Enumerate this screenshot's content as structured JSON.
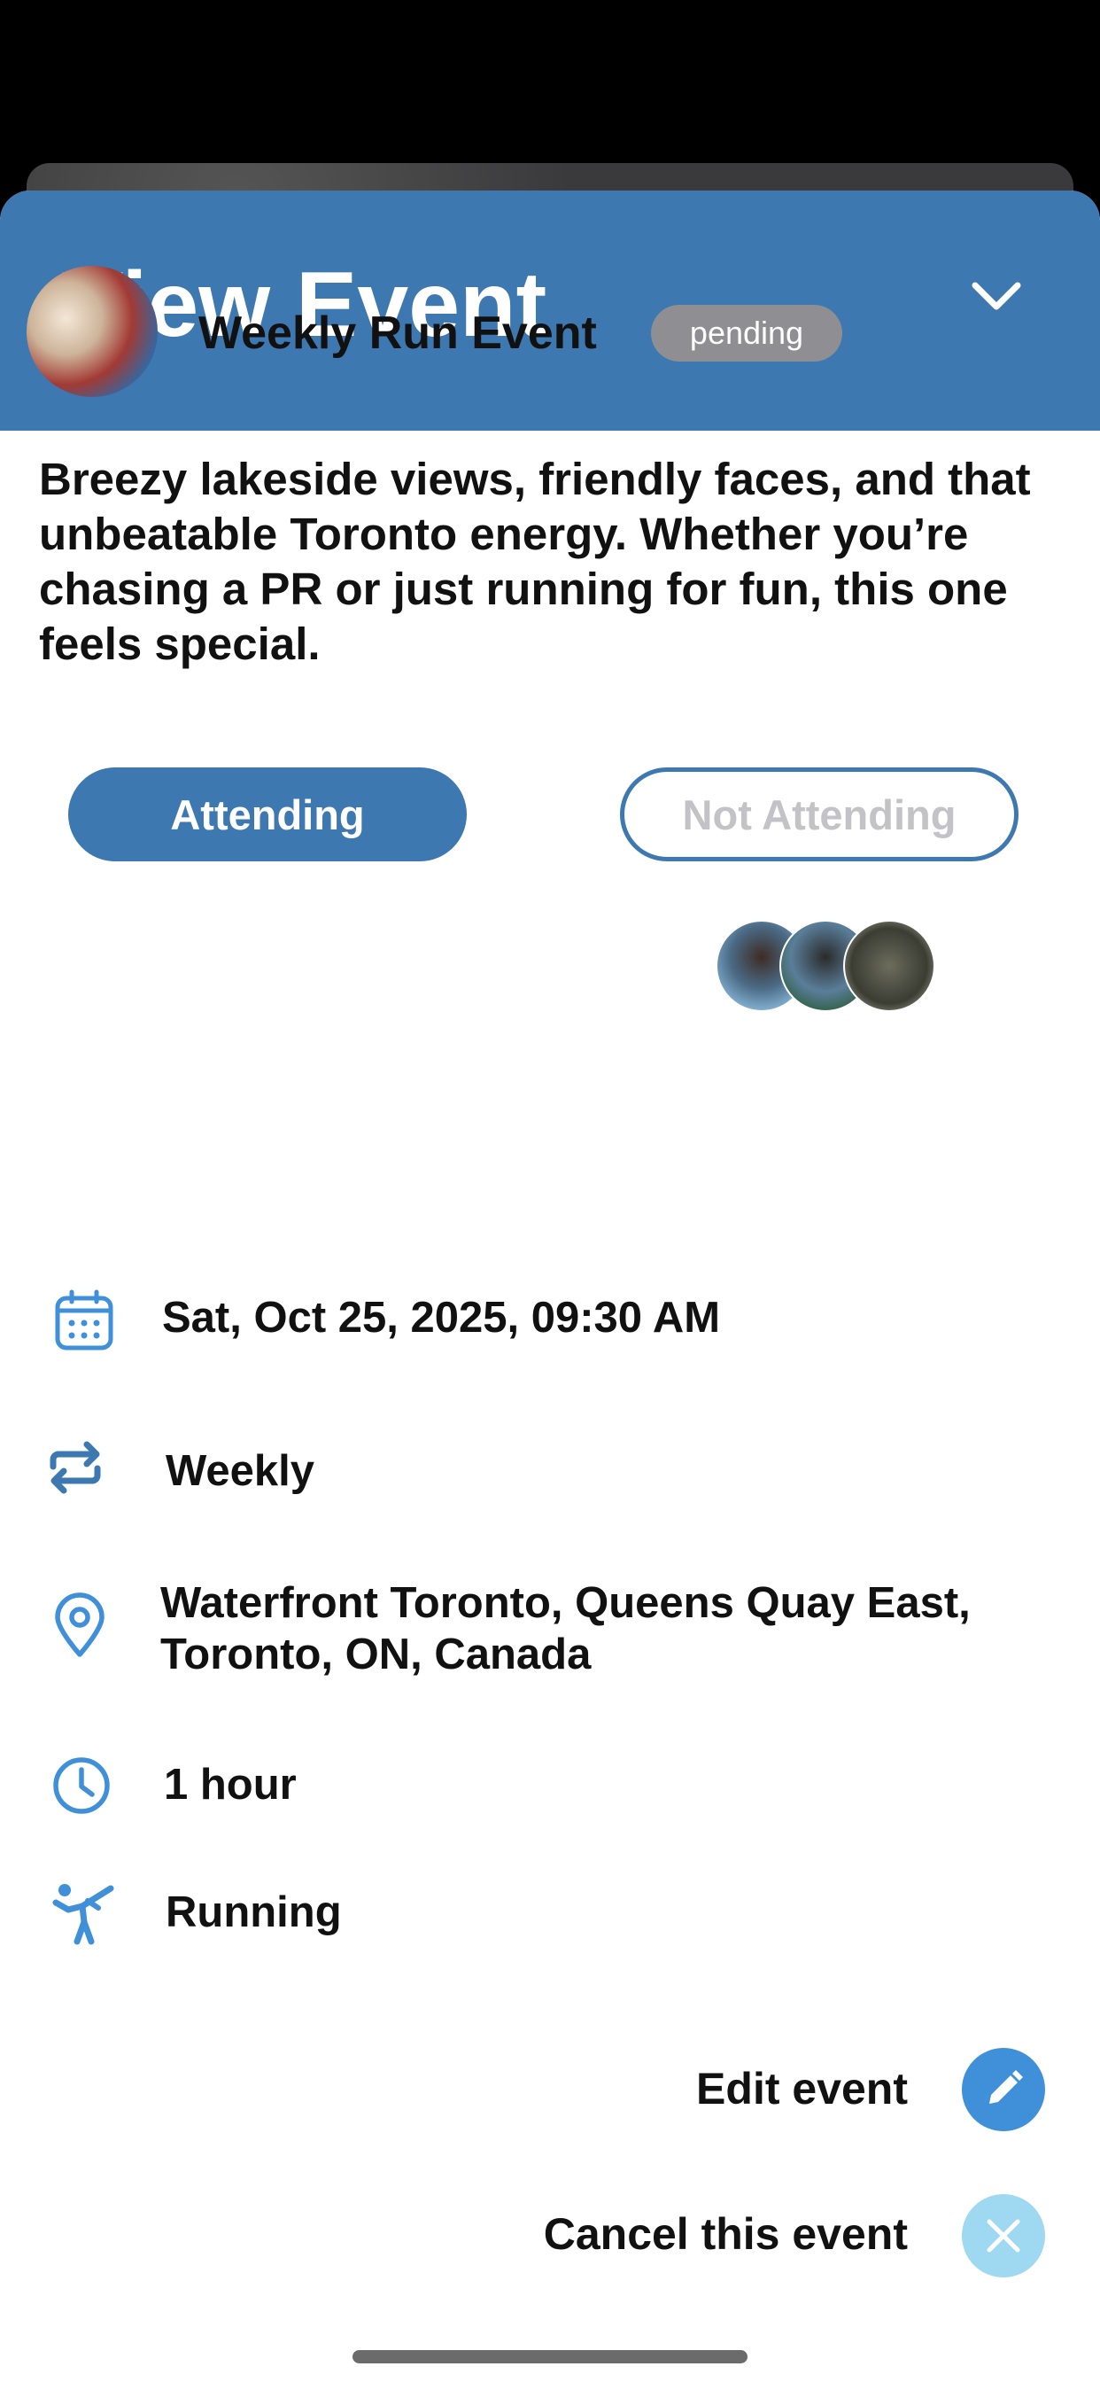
{
  "header": {
    "title": "View Event"
  },
  "event": {
    "name": "Weekly Run Event",
    "status": "pending",
    "description": "Breezy lakeside views, friendly faces, and that unbeatable Toronto energy. Whether you’re chasing a PR or just running for fun, this one feels special."
  },
  "rsvp": {
    "attending_label": "Attending",
    "not_attending_label": "Not Attending",
    "selected": "Attending"
  },
  "details": {
    "datetime": "Sat, Oct 25, 2025, 09:30 AM",
    "recurrence": "Weekly",
    "location_line1": "Waterfront Toronto, Queens Quay East,",
    "location_line2": "Toronto, ON, Canada",
    "duration": "1 hour",
    "activity": "Running"
  },
  "actions": {
    "edit_label": "Edit event",
    "cancel_label": "Cancel this event"
  },
  "colors": {
    "header_blue": "#3d78b1",
    "icon_blue": "#3f8fd9",
    "badge_gray": "#8e8e93",
    "cancel_light_blue": "#9fd8f1"
  },
  "icons": {
    "collapse": "chevron-down-icon",
    "date": "calendar-icon",
    "recurrence": "repeat-icon",
    "location": "location-pin-icon",
    "duration": "clock-icon",
    "activity": "running-figure-icon",
    "edit": "pencil-icon",
    "cancel": "close-icon"
  }
}
